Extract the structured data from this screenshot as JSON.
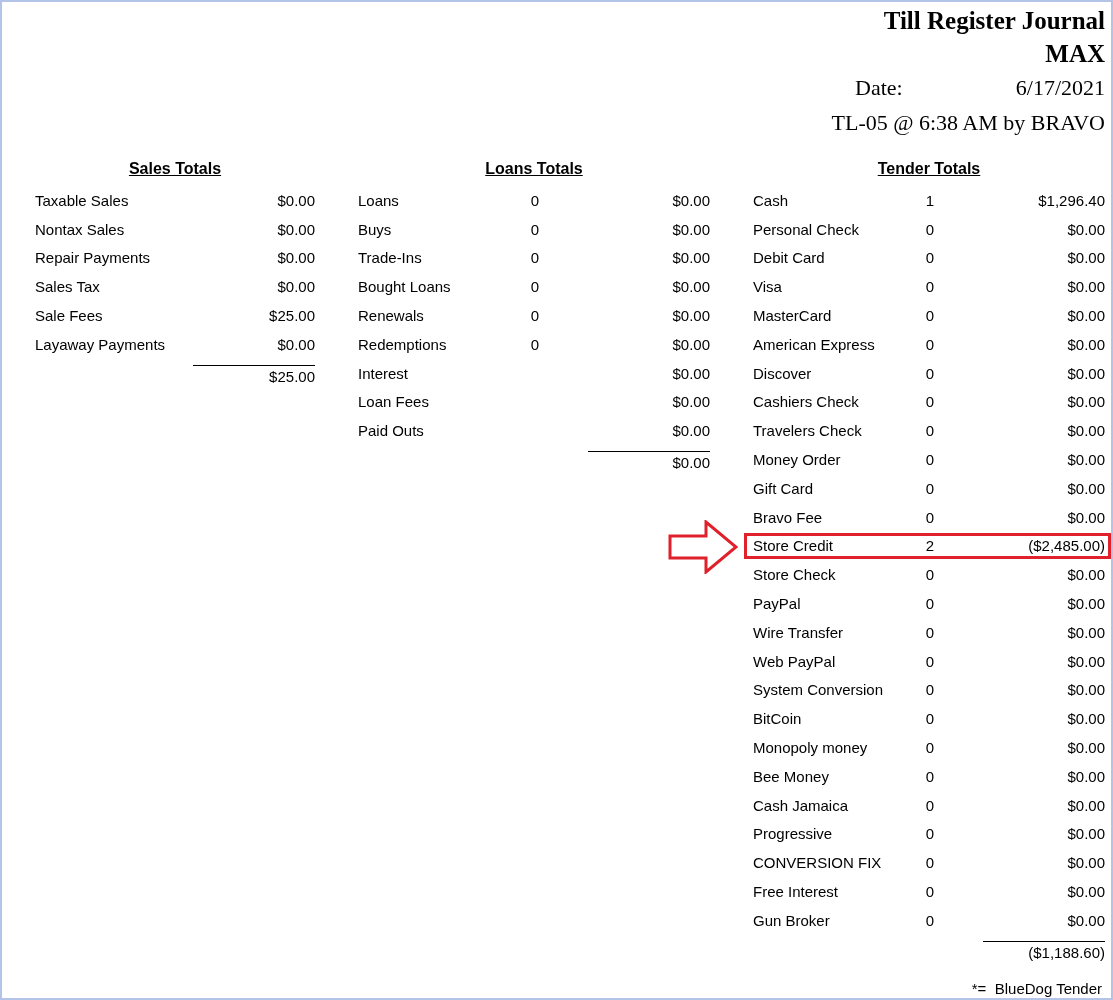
{
  "report": {
    "title": "Till Register Journal",
    "subtitle": "MAX",
    "date_label": "Date:",
    "date": "6/17/2021",
    "session": "TL-05 @ 6:38 AM by BRAVO"
  },
  "sales_totals": {
    "heading": "Sales Totals",
    "rows": [
      {
        "label": "Taxable Sales",
        "amount": "$0.00"
      },
      {
        "label": "Nontax Sales",
        "amount": "$0.00"
      },
      {
        "label": "Repair Payments",
        "amount": "$0.00"
      },
      {
        "label": "Sales Tax",
        "amount": "$0.00"
      },
      {
        "label": "Sale Fees",
        "amount": "$25.00"
      },
      {
        "label": "Layaway Payments",
        "amount": "$0.00"
      }
    ],
    "total": "$25.00"
  },
  "loans_totals": {
    "heading": "Loans Totals",
    "rows": [
      {
        "label": "Loans",
        "count": "0",
        "amount": "$0.00"
      },
      {
        "label": "Buys",
        "count": "0",
        "amount": "$0.00"
      },
      {
        "label": "Trade-Ins",
        "count": "0",
        "amount": "$0.00"
      },
      {
        "label": "Bought Loans",
        "count": "0",
        "amount": "$0.00"
      },
      {
        "label": "Renewals",
        "count": "0",
        "amount": "$0.00"
      },
      {
        "label": "Redemptions",
        "count": "0",
        "amount": "$0.00"
      },
      {
        "label": "Interest",
        "amount": "$0.00"
      },
      {
        "label": "Loan Fees",
        "amount": "$0.00"
      },
      {
        "label": "Paid Outs",
        "amount": "$0.00"
      }
    ],
    "total": "$0.00"
  },
  "tender_totals": {
    "heading": "Tender Totals",
    "rows": [
      {
        "label": "Cash",
        "count": "1",
        "amount": "$1,296.40",
        "highlighted": false
      },
      {
        "label": "Personal Check",
        "count": "0",
        "amount": "$0.00",
        "highlighted": false
      },
      {
        "label": "Debit Card",
        "count": "0",
        "amount": "$0.00",
        "highlighted": false
      },
      {
        "label": "Visa",
        "count": "0",
        "amount": "$0.00",
        "highlighted": false
      },
      {
        "label": "MasterCard",
        "count": "0",
        "amount": "$0.00",
        "highlighted": false
      },
      {
        "label": "American Express",
        "count": "0",
        "amount": "$0.00",
        "highlighted": false
      },
      {
        "label": "Discover",
        "count": "0",
        "amount": "$0.00",
        "highlighted": false
      },
      {
        "label": "Cashiers Check",
        "count": "0",
        "amount": "$0.00",
        "highlighted": false
      },
      {
        "label": "Travelers Check",
        "count": "0",
        "amount": "$0.00",
        "highlighted": false
      },
      {
        "label": "Money Order",
        "count": "0",
        "amount": "$0.00",
        "highlighted": false
      },
      {
        "label": "Gift Card",
        "count": "0",
        "amount": "$0.00",
        "highlighted": false
      },
      {
        "label": "Bravo Fee",
        "count": "0",
        "amount": "$0.00",
        "highlighted": false
      },
      {
        "label": "Store Credit",
        "count": "2",
        "amount": "($2,485.00)",
        "highlighted": true
      },
      {
        "label": "Store Check",
        "count": "0",
        "amount": "$0.00",
        "highlighted": false
      },
      {
        "label": "PayPal",
        "count": "0",
        "amount": "$0.00",
        "highlighted": false
      },
      {
        "label": "Wire Transfer",
        "count": "0",
        "amount": "$0.00",
        "highlighted": false
      },
      {
        "label": "Web PayPal",
        "count": "0",
        "amount": "$0.00",
        "highlighted": false
      },
      {
        "label": "System Conversion",
        "count": "0",
        "amount": "$0.00",
        "highlighted": false
      },
      {
        "label": "BitCoin",
        "count": "0",
        "amount": "$0.00",
        "highlighted": false
      },
      {
        "label": "Monopoly money",
        "count": "0",
        "amount": "$0.00",
        "highlighted": false
      },
      {
        "label": "Bee Money",
        "count": "0",
        "amount": "$0.00",
        "highlighted": false
      },
      {
        "label": "Cash Jamaica",
        "count": "0",
        "amount": "$0.00",
        "highlighted": false
      },
      {
        "label": "Progressive",
        "count": "0",
        "amount": "$0.00",
        "highlighted": false
      },
      {
        "label": "CONVERSION FIX",
        "count": "0",
        "amount": "$0.00",
        "highlighted": false
      },
      {
        "label": "Free Interest",
        "count": "0",
        "amount": "$0.00",
        "highlighted": false
      },
      {
        "label": "Gun Broker",
        "count": "0",
        "amount": "$0.00",
        "highlighted": false
      }
    ],
    "total": "($1,188.60)"
  },
  "footnote": "*=  BlueDog Tender"
}
